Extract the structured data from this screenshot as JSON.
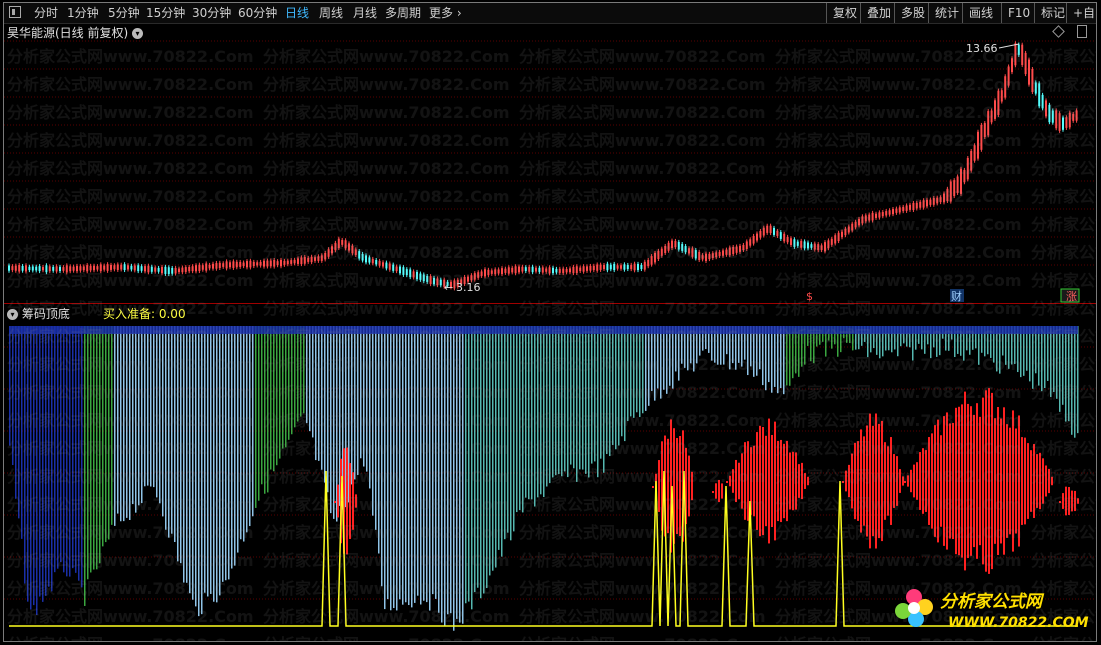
{
  "toolbar": {
    "periods": [
      "分时",
      "1分钟",
      "5分钟",
      "15分钟",
      "30分钟",
      "60分钟",
      "日线",
      "周线",
      "月线",
      "多周期",
      "更多"
    ],
    "active_index": 6,
    "right_buttons": [
      "复权",
      "叠加",
      "多股",
      "统计",
      "画线",
      "F10",
      "标记",
      "+自"
    ]
  },
  "main_pane": {
    "title": "昊华能源(日线 前复权)",
    "high_label": "13.66",
    "low_label": "3.16",
    "markers": {
      "s_marker": "$",
      "cai_marker": "财",
      "zhang_marker": "涨"
    }
  },
  "indicator_pane": {
    "title": "筹码顶底",
    "buy_label": "买入准备: 0.00"
  },
  "watermark": {
    "text": "分析家公式网www.70822.Com"
  },
  "logo": {
    "title": "分析家公式网",
    "url": "WWW.70822.COM"
  },
  "colors": {
    "up": "#ff4b4b",
    "down": "#54ffff",
    "grid": "#5a0000",
    "indicator_red": "#ff2020",
    "indicator_yellow": "#ffff20",
    "chip_blue": "#1a2fa8",
    "chip_light": "#8fc4e8",
    "chip_cyan": "#55b7b0",
    "chip_green": "#3aa640"
  }
}
